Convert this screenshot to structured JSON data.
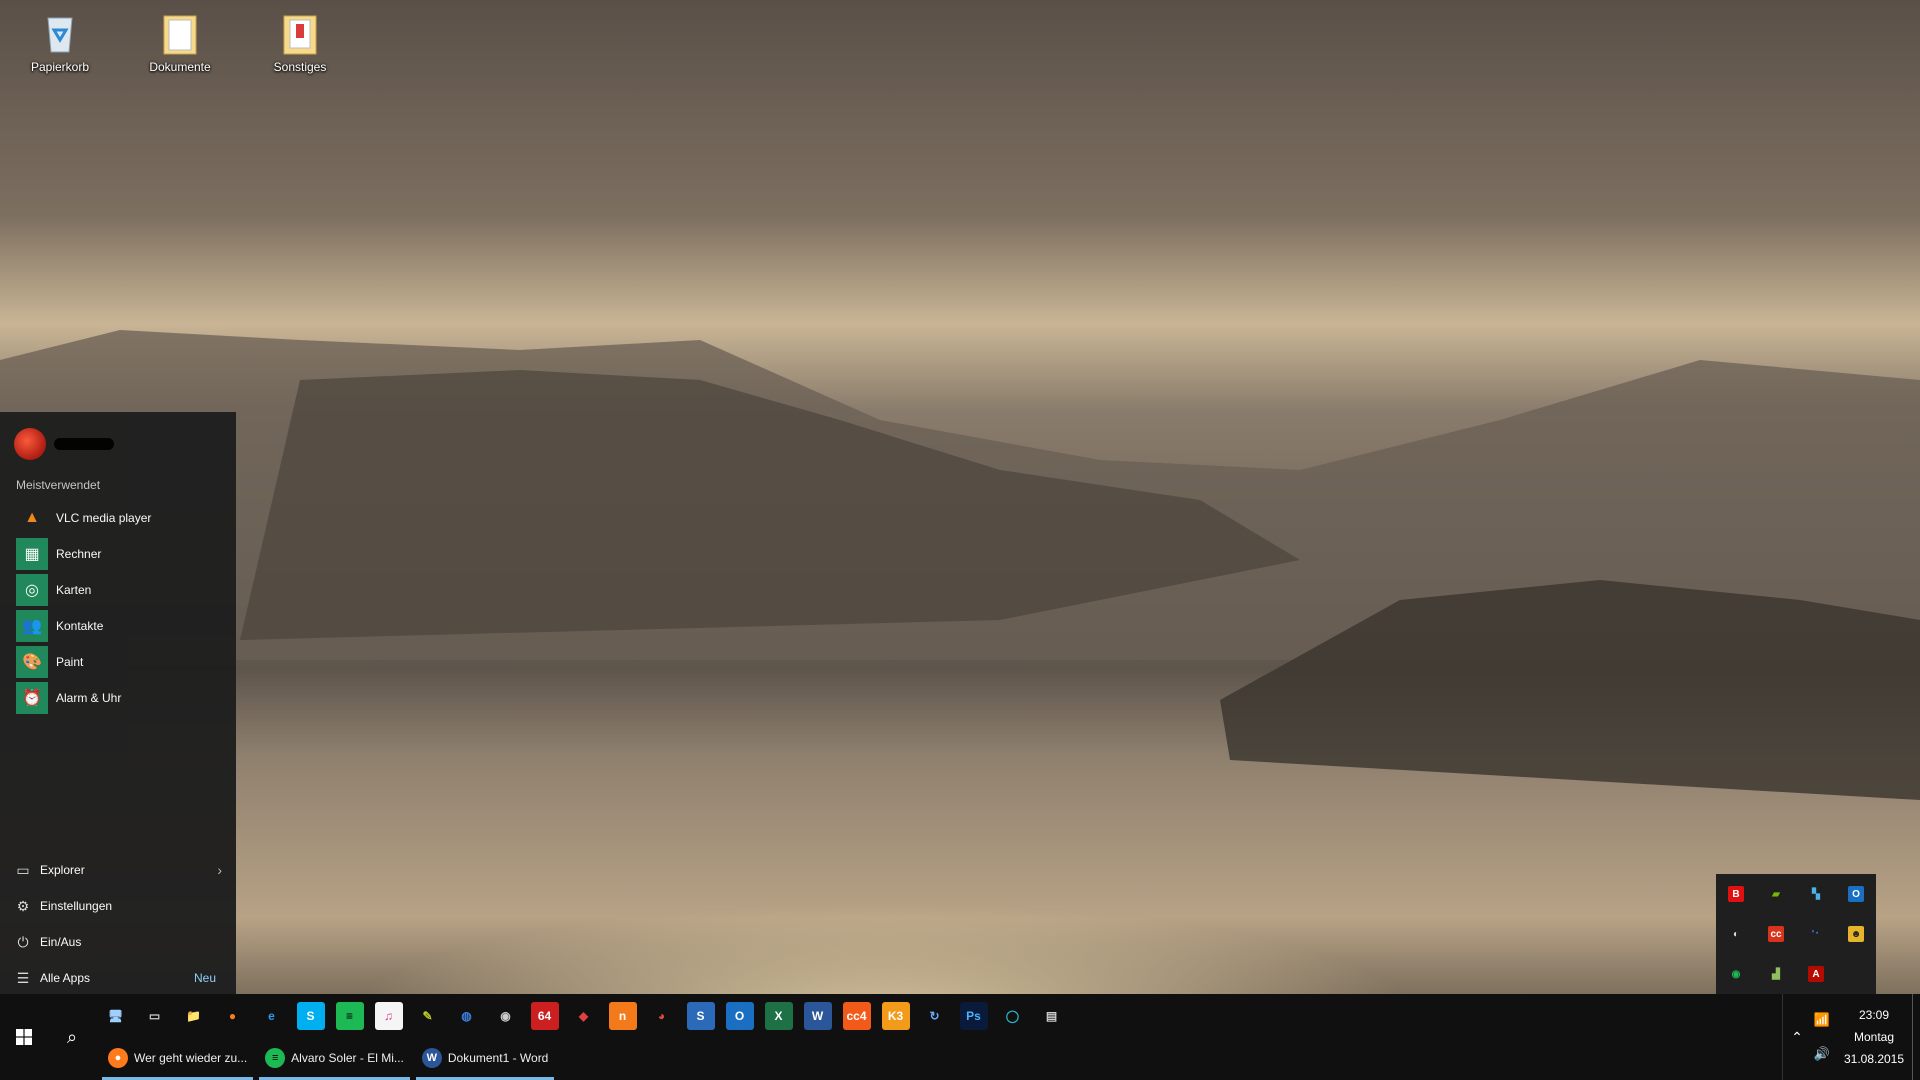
{
  "desktop": {
    "icons": [
      {
        "label": "Papierkorb",
        "icon": "recycle-bin-icon"
      },
      {
        "label": "Dokumente",
        "icon": "folder-icon"
      },
      {
        "label": "Sonstiges",
        "icon": "folder-icon"
      }
    ]
  },
  "start_menu": {
    "most_used_heading": "Meistverwendet",
    "apps": [
      {
        "label": "VLC media player",
        "icon": "vlc-icon",
        "glyph": "▲"
      },
      {
        "label": "Rechner",
        "icon": "calculator-icon",
        "glyph": "▦"
      },
      {
        "label": "Karten",
        "icon": "maps-icon",
        "glyph": "◎"
      },
      {
        "label": "Kontakte",
        "icon": "people-icon",
        "glyph": "👥"
      },
      {
        "label": "Paint",
        "icon": "paint-icon",
        "glyph": "🎨"
      },
      {
        "label": "Alarm & Uhr",
        "icon": "alarm-clock-icon",
        "glyph": "⏰"
      }
    ],
    "bottom": {
      "explorer": "Explorer",
      "settings": "Einstellungen",
      "power": "Ein/Aus",
      "all_apps": "Alle Apps",
      "new_badge": "Neu"
    }
  },
  "tray_flyout": [
    {
      "name": "bitdefender-icon",
      "glyph": "B",
      "bg": "#e01010",
      "fg": "#ffffff"
    },
    {
      "name": "nvidia-icon",
      "glyph": "▰",
      "bg": "#1f1f1f",
      "fg": "#76b900"
    },
    {
      "name": "network-monitor-icon",
      "glyph": "▚",
      "bg": "#1f1f1f",
      "fg": "#4ab3e8"
    },
    {
      "name": "outlook-tray-icon",
      "glyph": "O",
      "bg": "#1b6fc2",
      "fg": "#ffffff"
    },
    {
      "name": "sync-icon",
      "glyph": "◐",
      "bg": "#1f1f1f",
      "fg": "#dddddd"
    },
    {
      "name": "adobe-cc-tray-icon",
      "glyph": "cc",
      "bg": "#d8341c",
      "fg": "#ffffff"
    },
    {
      "name": "bluetooth-audio-icon",
      "glyph": "ʹ᛫",
      "bg": "#1f1f1f",
      "fg": "#3f7fff"
    },
    {
      "name": "shield-tray-icon",
      "glyph": "☻",
      "bg": "#e6b42a",
      "fg": "#222222"
    },
    {
      "name": "spotify-tray-icon",
      "glyph": "◉",
      "bg": "#1f1f1f",
      "fg": "#1db954"
    },
    {
      "name": "device-manager-icon",
      "glyph": "▟",
      "bg": "#1f1f1f",
      "fg": "#8fbf5f"
    },
    {
      "name": "adobe-reader-tray-icon",
      "glyph": "A",
      "bg": "#b30b00",
      "fg": "#ffffff"
    },
    {
      "name": "empty-slot",
      "glyph": "",
      "bg": "#1f1f1f",
      "fg": "#1f1f1f"
    }
  ],
  "taskbar": {
    "pinned": [
      {
        "name": "this-pc-icon",
        "glyph": "🖥",
        "bg": "transparent",
        "fg": "#9fd0ff"
      },
      {
        "name": "scanner-icon",
        "glyph": "▭",
        "bg": "transparent",
        "fg": "#cccccc"
      },
      {
        "name": "file-explorer-icon",
        "glyph": "📁",
        "bg": "transparent",
        "fg": "#f2c443"
      },
      {
        "name": "firefox-icon",
        "glyph": "●",
        "bg": "transparent",
        "fg": "#ff7a1a"
      },
      {
        "name": "internet-explorer-icon",
        "glyph": "e",
        "bg": "transparent",
        "fg": "#2b9af3"
      },
      {
        "name": "skype-icon",
        "glyph": "S",
        "bg": "#00aff0",
        "fg": "#ffffff"
      },
      {
        "name": "spotify-icon",
        "glyph": "≡",
        "bg": "#1db954",
        "fg": "#000000"
      },
      {
        "name": "itunes-icon",
        "glyph": "♫",
        "bg": "#f5f5f5",
        "fg": "#d83c8c"
      },
      {
        "name": "paint-net-icon",
        "glyph": "✎",
        "bg": "transparent",
        "fg": "#b8c920"
      },
      {
        "name": "google-earth-icon",
        "glyph": "◍",
        "bg": "transparent",
        "fg": "#3a7fdc"
      },
      {
        "name": "webcam-icon",
        "glyph": "◉",
        "bg": "transparent",
        "fg": "#cccccc"
      },
      {
        "name": "c64-emulator-icon",
        "glyph": "64",
        "bg": "#cc1f1f",
        "fg": "#ffffff"
      },
      {
        "name": "burning-app-icon",
        "glyph": "◆",
        "bg": "transparent",
        "fg": "#e04040"
      },
      {
        "name": "orange-app-icon",
        "glyph": "n",
        "bg": "#f27a1a",
        "fg": "#ffffff"
      },
      {
        "name": "chrome-icon",
        "glyph": "◕",
        "bg": "transparent",
        "fg": "#e24b3b"
      },
      {
        "name": "word-s-icon",
        "glyph": "S",
        "bg": "#2a6ab8",
        "fg": "#ffffff"
      },
      {
        "name": "outlook-icon",
        "glyph": "O",
        "bg": "#1b6fc2",
        "fg": "#ffffff"
      },
      {
        "name": "excel-icon",
        "glyph": "X",
        "bg": "#1e7145",
        "fg": "#ffffff"
      },
      {
        "name": "word-icon",
        "glyph": "W",
        "bg": "#2b579a",
        "fg": "#ffffff"
      },
      {
        "name": "cc4-icon",
        "glyph": "cc4",
        "bg": "#f25a1a",
        "fg": "#ffffff"
      },
      {
        "name": "k3-app-icon",
        "glyph": "K3",
        "bg": "#f29a1a",
        "fg": "#ffffff"
      },
      {
        "name": "refresh-app-icon",
        "glyph": "↻",
        "bg": "transparent",
        "fg": "#6aa8ff"
      },
      {
        "name": "photoshop-icon",
        "glyph": "Ps",
        "bg": "#0a1a3a",
        "fg": "#4ab3ff"
      },
      {
        "name": "circle-app-icon",
        "glyph": "◯",
        "bg": "transparent",
        "fg": "#2ab0c8"
      },
      {
        "name": "installer-icon",
        "glyph": "▤",
        "bg": "transparent",
        "fg": "#cccccc"
      }
    ],
    "windows": [
      {
        "label": "Wer geht wieder zu...",
        "name": "window-firefox",
        "glyph": "●",
        "bg": "#ff7a1a",
        "fg": "#ffffff"
      },
      {
        "label": "Alvaro Soler - El Mi...",
        "name": "window-spotify",
        "glyph": "≡",
        "bg": "#1db954",
        "fg": "#000000"
      },
      {
        "label": "Dokument1 - Word",
        "name": "window-word",
        "glyph": "W",
        "bg": "#2b579a",
        "fg": "#ffffff"
      }
    ],
    "clock": {
      "time": "23:09",
      "day": "Montag",
      "date": "31.08.2015"
    }
  }
}
